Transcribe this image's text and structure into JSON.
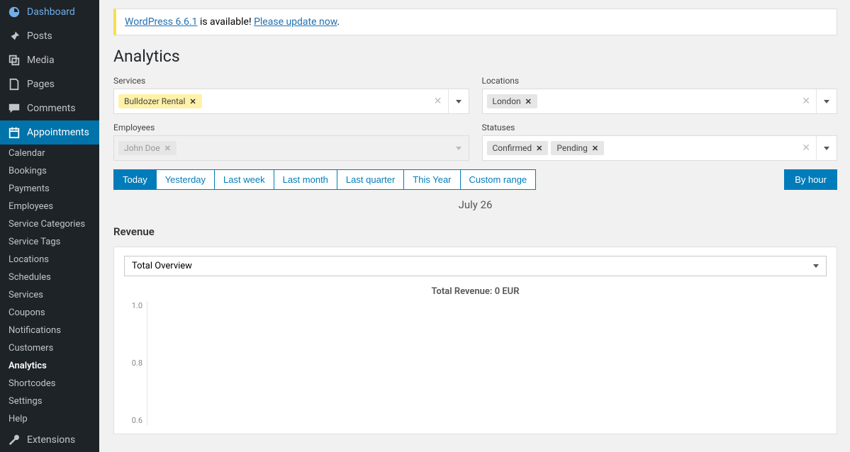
{
  "nav": {
    "dashboard": "Dashboard",
    "posts": "Posts",
    "media": "Media",
    "pages": "Pages",
    "comments": "Comments",
    "appointments": "Appointments",
    "extensions": "Extensions"
  },
  "subnav": {
    "calendar": "Calendar",
    "bookings": "Bookings",
    "payments": "Payments",
    "employees": "Employees",
    "service_categories": "Service Categories",
    "service_tags": "Service Tags",
    "locations": "Locations",
    "schedules": "Schedules",
    "services": "Services",
    "coupons": "Coupons",
    "notifications": "Notifications",
    "customers": "Customers",
    "analytics": "Analytics",
    "shortcodes": "Shortcodes",
    "settings": "Settings",
    "help": "Help"
  },
  "notice": {
    "version_link": "WordPress 6.6.1",
    "available_text": " is available! ",
    "update_link": "Please update now"
  },
  "page_title": "Analytics",
  "filters": {
    "services": {
      "label": "Services",
      "chip": "Bulldozer Rental"
    },
    "locations": {
      "label": "Locations",
      "chip": "London"
    },
    "employees": {
      "label": "Employees",
      "chip": "John Doe"
    },
    "statuses": {
      "label": "Statuses",
      "chip1": "Confirmed",
      "chip2": "Pending"
    }
  },
  "ranges": {
    "today": "Today",
    "yesterday": "Yesterday",
    "last_week": "Last week",
    "last_month": "Last month",
    "last_quarter": "Last quarter",
    "this_year": "This Year",
    "custom": "Custom range",
    "by_hour": "By hour"
  },
  "date_label": "July 26",
  "revenue": {
    "title": "Revenue",
    "dropdown": "Total Overview"
  },
  "chart_data": {
    "type": "line",
    "title": "Total Revenue: 0 EUR",
    "xlabel": "",
    "ylabel": "",
    "ylim": [
      0,
      1
    ],
    "yticks": [
      "1.0",
      "0.8",
      "0.6"
    ],
    "categories": [],
    "values": []
  }
}
